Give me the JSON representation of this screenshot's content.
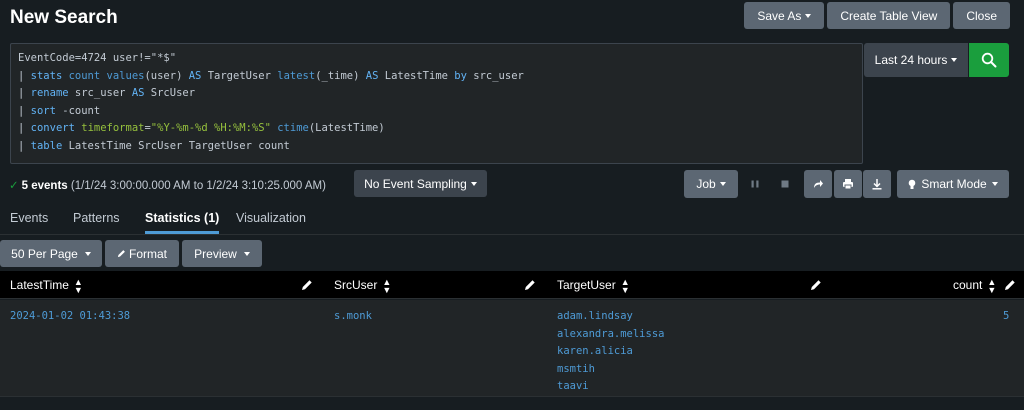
{
  "header": {
    "title": "New Search",
    "save_as": "Save As",
    "create_table_view": "Create Table View",
    "close": "Close"
  },
  "query": {
    "lines": [
      [
        {
          "t": "w",
          "v": "EventCode=4724 user!=\"*$\""
        }
      ],
      [
        {
          "t": "w",
          "v": "| "
        },
        {
          "t": "k",
          "v": "stats"
        },
        {
          "t": "w",
          "v": " "
        },
        {
          "t": "f",
          "v": "count"
        },
        {
          "t": "w",
          "v": " "
        },
        {
          "t": "f",
          "v": "values"
        },
        {
          "t": "w",
          "v": "(user) "
        },
        {
          "t": "k",
          "v": "AS"
        },
        {
          "t": "w",
          "v": " TargetUser "
        },
        {
          "t": "f",
          "v": "latest"
        },
        {
          "t": "w",
          "v": "(_time) "
        },
        {
          "t": "k",
          "v": "AS"
        },
        {
          "t": "w",
          "v": " LatestTime "
        },
        {
          "t": "k",
          "v": "by"
        },
        {
          "t": "w",
          "v": " src_user"
        }
      ],
      [
        {
          "t": "w",
          "v": "| "
        },
        {
          "t": "k",
          "v": "rename"
        },
        {
          "t": "w",
          "v": " src_user "
        },
        {
          "t": "k",
          "v": "AS"
        },
        {
          "t": "w",
          "v": " SrcUser"
        }
      ],
      [
        {
          "t": "w",
          "v": "| "
        },
        {
          "t": "k",
          "v": "sort"
        },
        {
          "t": "w",
          "v": " -count"
        }
      ],
      [
        {
          "t": "w",
          "v": "| "
        },
        {
          "t": "k",
          "v": "convert"
        },
        {
          "t": "w",
          "v": " "
        },
        {
          "t": "s",
          "v": "timeformat"
        },
        {
          "t": "w",
          "v": "="
        },
        {
          "t": "s",
          "v": "\"%Y-%m-%d %H:%M:%S\""
        },
        {
          "t": "w",
          "v": " "
        },
        {
          "t": "f",
          "v": "ctime"
        },
        {
          "t": "w",
          "v": "(LatestTime)"
        }
      ],
      [
        {
          "t": "w",
          "v": "| "
        },
        {
          "t": "k",
          "v": "table"
        },
        {
          "t": "w",
          "v": " LatestTime SrcUser TargetUser count"
        }
      ]
    ]
  },
  "time_picker": {
    "label": "Last 24 hours"
  },
  "status": {
    "check": "✓",
    "count_label": "5 events",
    "range": " (1/1/24 3:00:00.000 AM to 1/2/24 3:10:25.000 AM)"
  },
  "sampling": {
    "label": "No Event Sampling"
  },
  "job": {
    "label": "Job"
  },
  "mode": {
    "label": "Smart Mode"
  },
  "tabs": [
    {
      "label": "Events"
    },
    {
      "label": "Patterns"
    },
    {
      "label": "Statistics (1)"
    },
    {
      "label": "Visualization"
    }
  ],
  "table_toolbar": {
    "per_page": "50 Per Page",
    "format": "Format",
    "preview": "Preview"
  },
  "table": {
    "columns": [
      "LatestTime",
      "SrcUser",
      "TargetUser",
      "count"
    ],
    "rows": [
      {
        "latest_time": "2024-01-02 01:43:38",
        "src_user": "s.monk",
        "target_users": [
          "adam.lindsay",
          "alexandra.melissa",
          "karen.alicia",
          "msmtih",
          "taavi"
        ],
        "count": "5"
      }
    ]
  },
  "colors": {
    "accent": "#4e9bd6",
    "search_green": "#1a9e3d",
    "background": "#171d21"
  }
}
